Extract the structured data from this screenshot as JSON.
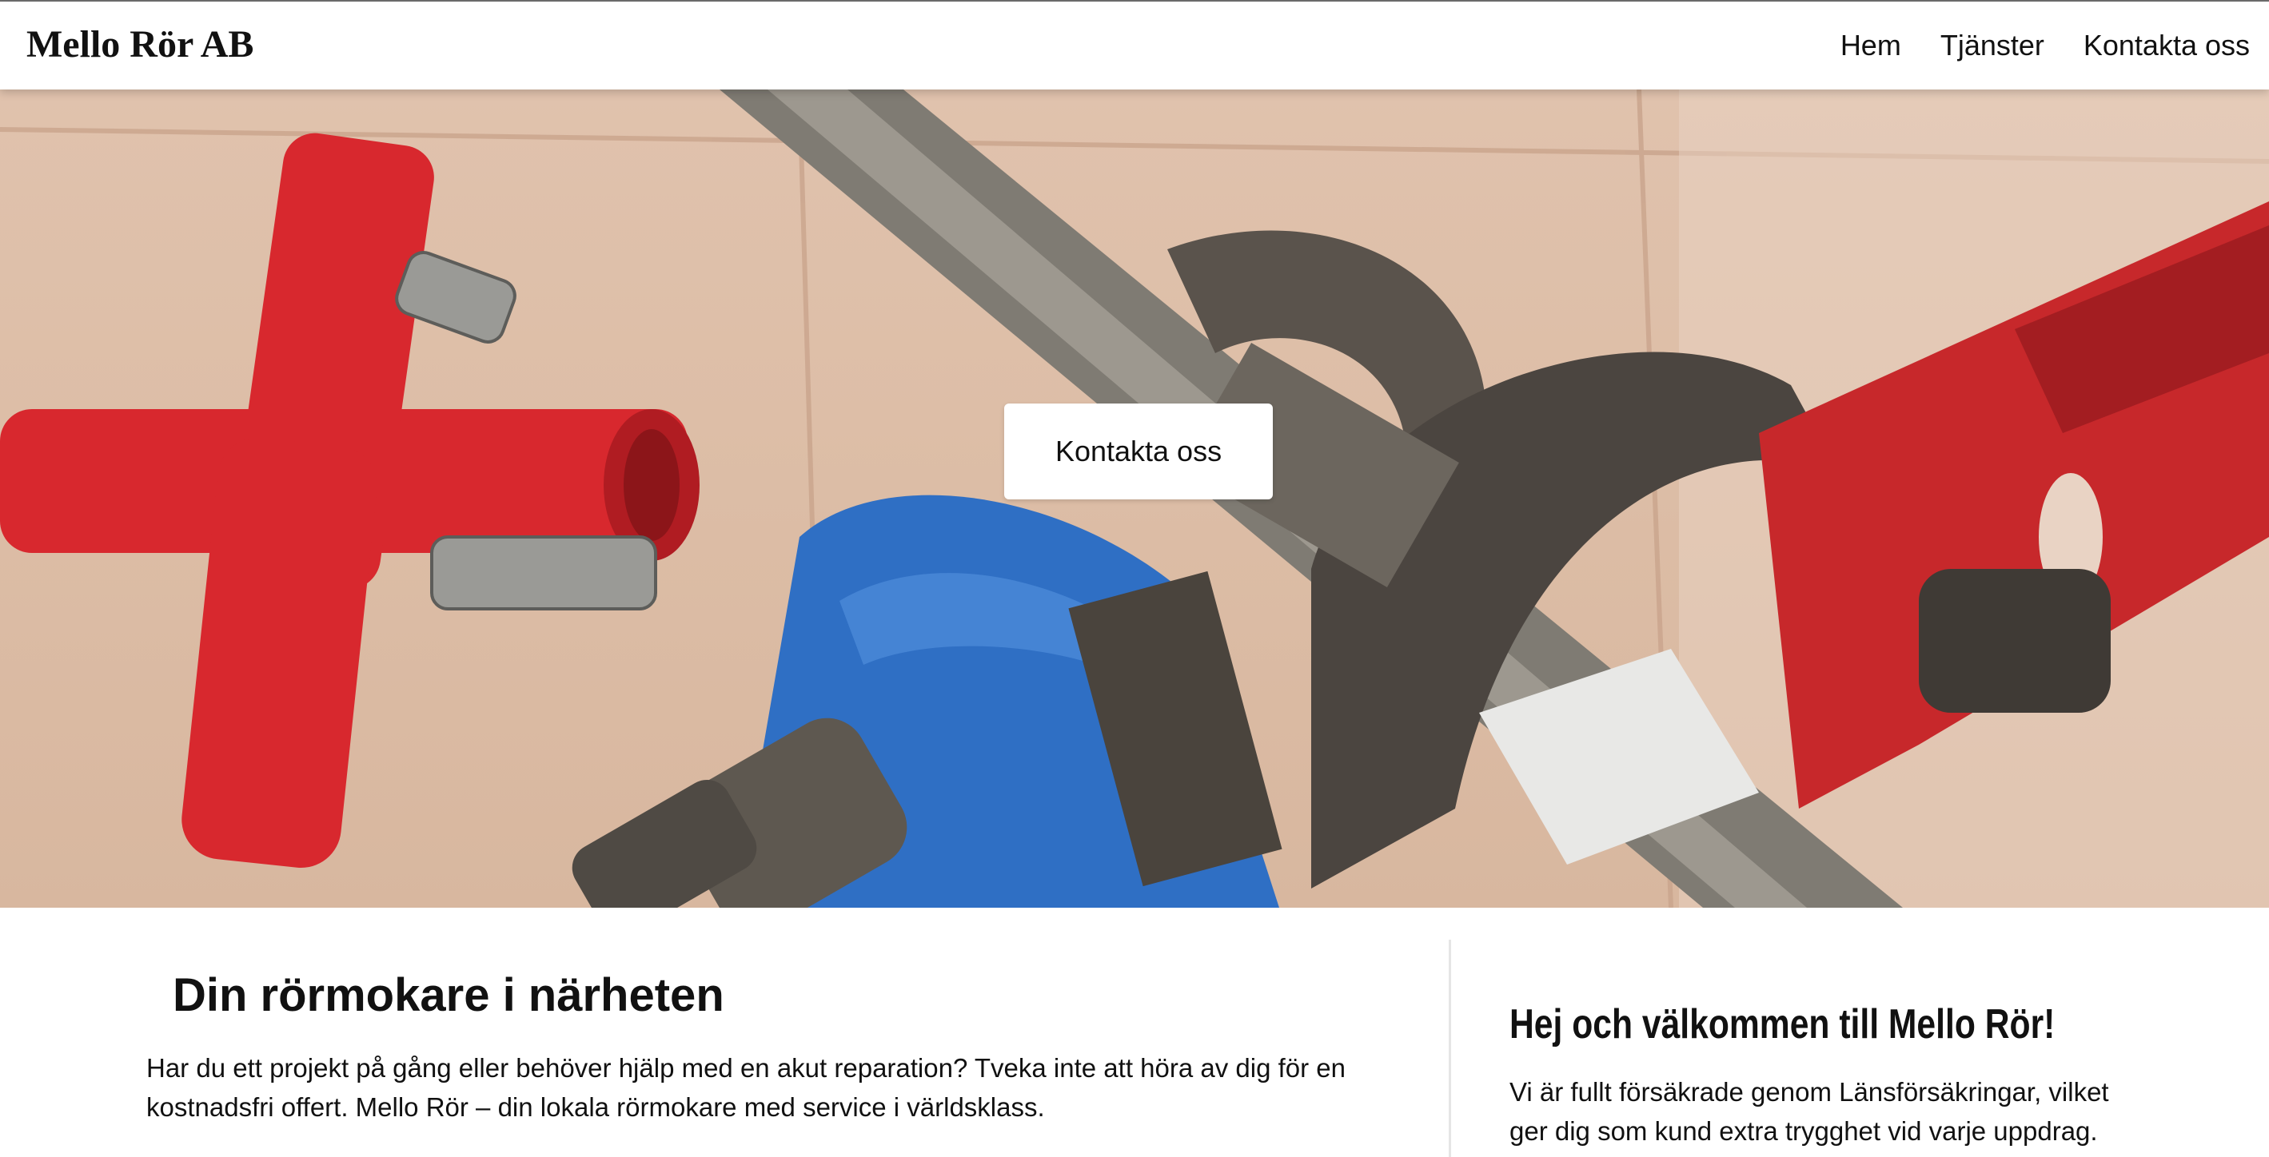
{
  "brand": {
    "name": "Mello Rör AB"
  },
  "nav": {
    "items": [
      {
        "label": "Hem"
      },
      {
        "label": "Tjänster"
      },
      {
        "label": "Kontakta oss"
      }
    ]
  },
  "hero": {
    "image_description_icon": "wrenches-photo",
    "cta_label": "Kontakta oss"
  },
  "main": {
    "title": "Din rörmokare i närheten",
    "text": "Har du ett projekt på gång eller behöver hjälp med en akut reparation? Tveka inte att höra av dig för en kostnadsfri offert. Mello Rör – din lokala rörmokare med service i världsklass."
  },
  "aside": {
    "title": "Hej och välkommen till Mello Rör!",
    "text": "Vi är fullt försäkrade genom Länsförsäkringar, vilket ger dig som kund extra trygghet vid varje uppdrag."
  },
  "colors": {
    "nav_bg": "#ffffff",
    "hero_tile": "#e0c2ad",
    "red_tool": "#d8282e",
    "blue_wrench": "#2f6fc4",
    "steel": "#8a857c"
  }
}
